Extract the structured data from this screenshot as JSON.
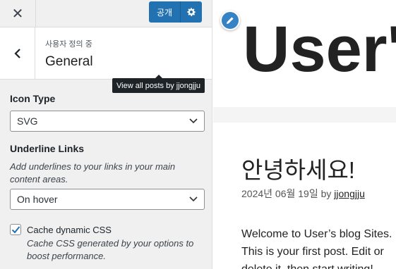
{
  "topbar": {
    "close_label": "✕",
    "publish_label": "공개"
  },
  "section": {
    "subtitle": "사용자 정의 중",
    "title": "General"
  },
  "tooltip": "View all posts by jjongjju",
  "fields": {
    "icon_type": {
      "label": "Icon Type",
      "value": "SVG"
    },
    "underline_links": {
      "label": "Underline Links",
      "description": "Add underlines to your links in your main content areas.",
      "value": "On hover"
    },
    "cache_css": {
      "label": "Cache dynamic CSS",
      "checked": true,
      "description": "Cache CSS generated by your options to boost performance."
    }
  },
  "preview": {
    "site_title": "User's blog",
    "post_title": "안녕하세요!",
    "post_date": "2024년 06월 19일",
    "by_label": "by",
    "author": "jjongjju",
    "body": "Welcome to User’s blog Sites. This is your first post. Edit or delete it, then start writing!"
  },
  "colors": {
    "accent": "#2271b1",
    "edit_shortcut": "#3582c4",
    "panel_bg": "#f0f0f1"
  }
}
